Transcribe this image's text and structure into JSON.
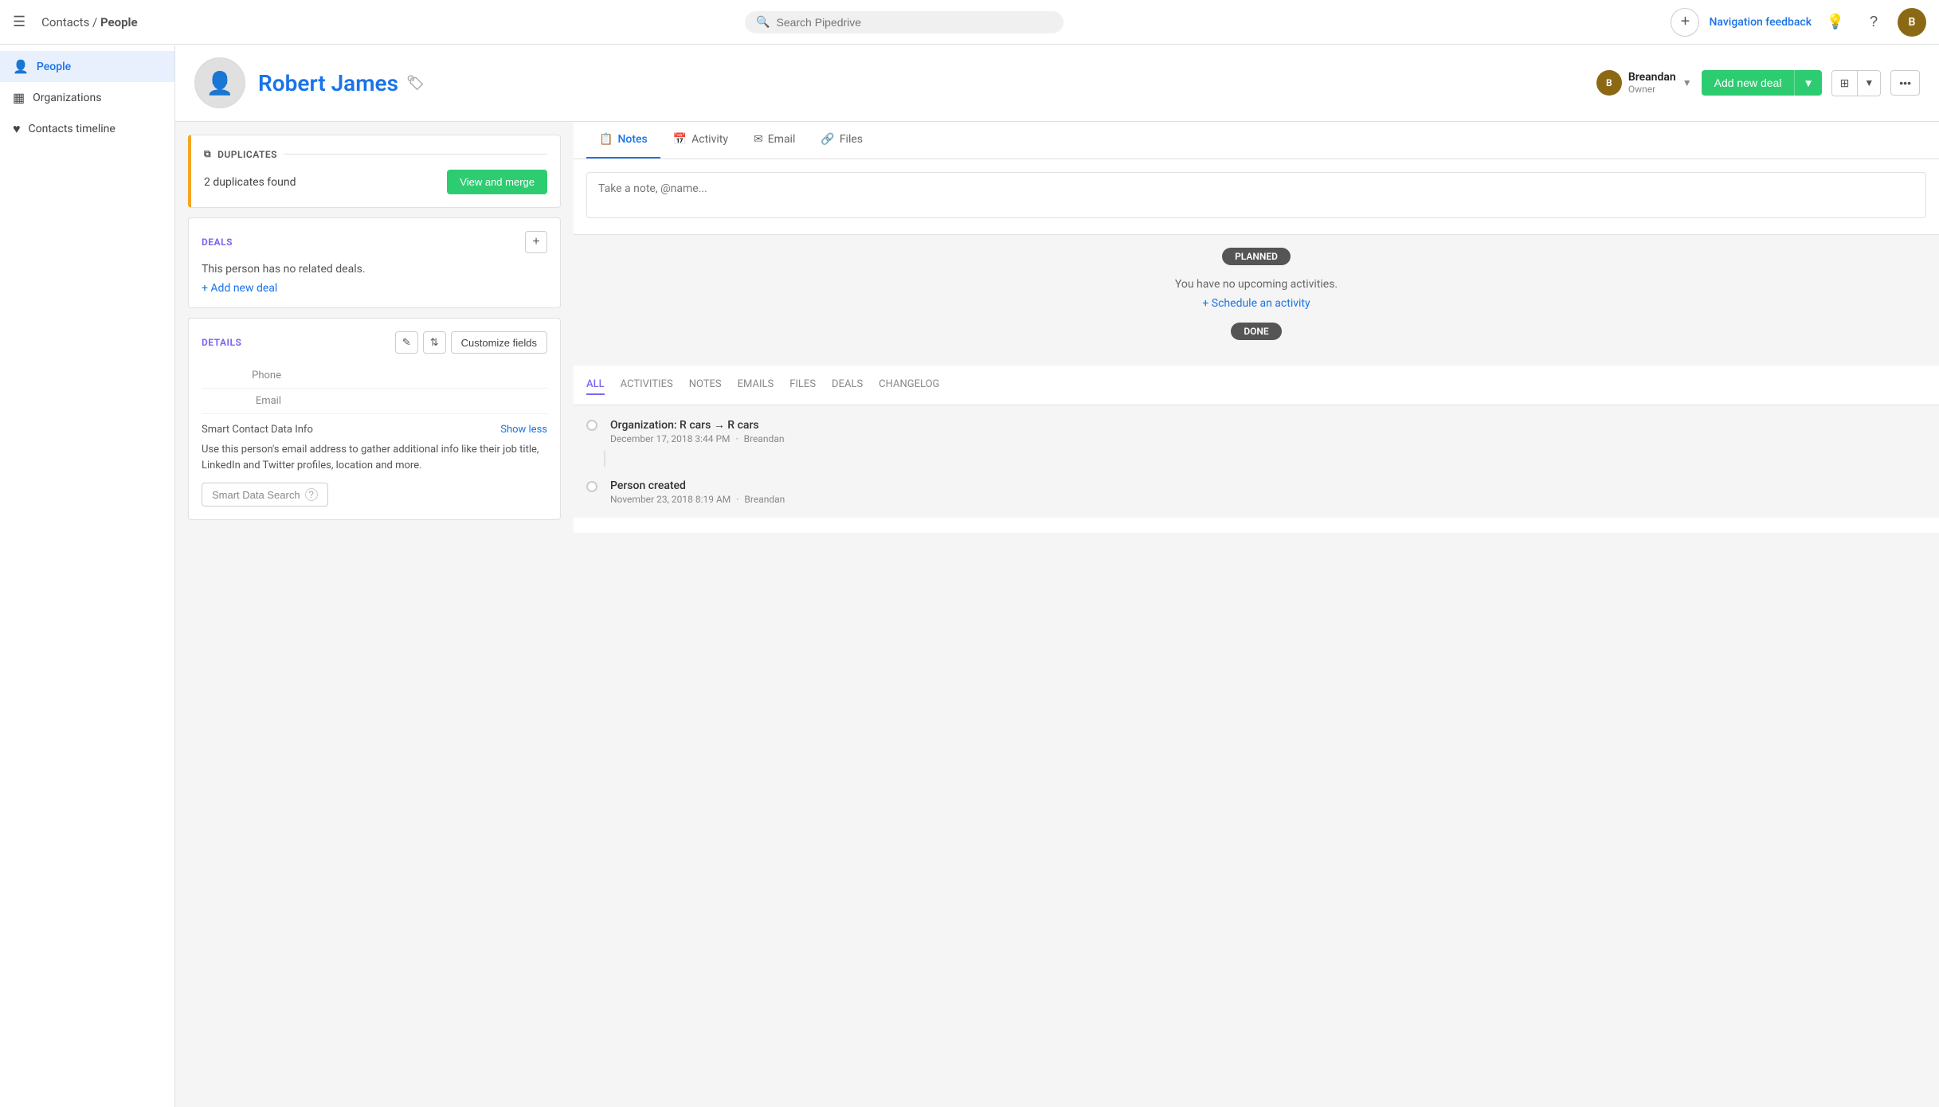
{
  "topNav": {
    "hamburger": "☰",
    "breadcrumb": "Contacts / ",
    "breadcrumbBold": "People",
    "searchPlaceholder": "Search Pipedrive",
    "addButtonLabel": "+",
    "feedbackLabel": "Navigation feedback",
    "lightbulbIcon": "💡",
    "helpIcon": "?",
    "avatarInitials": "B"
  },
  "sidebar": {
    "items": [
      {
        "id": "people",
        "icon": "👤",
        "label": "People",
        "active": true
      },
      {
        "id": "organizations",
        "icon": "▦",
        "label": "Organizations",
        "active": false
      },
      {
        "id": "contacts-timeline",
        "icon": "♥",
        "label": "Contacts timeline",
        "active": false
      }
    ]
  },
  "personHeader": {
    "avatarIcon": "👤",
    "name": "Robert James",
    "tagIcon": "🏷",
    "owner": {
      "name": "Breandan",
      "label": "Owner",
      "avatarInitials": "B"
    },
    "addDealLabel": "Add new deal",
    "viewToggleIcon": "⊞",
    "moreIcon": "•••"
  },
  "duplicatesCard": {
    "icon": "⧉",
    "title": "DUPLICATES",
    "message": "2 duplicates found",
    "buttonLabel": "View and merge"
  },
  "dealsCard": {
    "title": "DEALS",
    "noDealsText": "This person has no related deals.",
    "addDealLink": "+ Add new deal"
  },
  "detailsCard": {
    "title": "DETAILS",
    "editIcon": "✎",
    "sortIcon": "⇅",
    "customizeLabel": "Customize fields",
    "fields": [
      {
        "label": "Phone",
        "value": ""
      },
      {
        "label": "Email",
        "value": ""
      }
    ],
    "smartContact": {
      "title": "Smart Contact Data Info",
      "showLessLabel": "Show less",
      "description": "Use this person's email address to gather additional info like their job title, LinkedIn and Twitter profiles, location and more.",
      "buttonLabel": "Smart Data Search",
      "buttonIcon": "?"
    }
  },
  "rightPanel": {
    "tabs": [
      {
        "id": "notes",
        "icon": "📋",
        "label": "Notes",
        "active": true
      },
      {
        "id": "activity",
        "icon": "📅",
        "label": "Activity",
        "active": false
      },
      {
        "id": "email",
        "icon": "✉",
        "label": "Email",
        "active": false
      },
      {
        "id": "files",
        "icon": "🔗",
        "label": "Files",
        "active": false
      }
    ],
    "notePlaceholder": "Take a note, @name...",
    "planned": {
      "badge": "PLANNED",
      "noActivitiesText": "You have no upcoming activities.",
      "scheduleLink": "+ Schedule an activity"
    },
    "done": {
      "badge": "DONE"
    },
    "historyTabs": [
      {
        "id": "all",
        "label": "ALL",
        "active": true
      },
      {
        "id": "activities",
        "label": "ACTIVITIES",
        "active": false
      },
      {
        "id": "notes",
        "label": "NOTES",
        "active": false
      },
      {
        "id": "emails",
        "label": "EMAILS",
        "active": false
      },
      {
        "id": "files",
        "label": "FILES",
        "active": false
      },
      {
        "id": "deals",
        "label": "DEALS",
        "active": false
      },
      {
        "id": "changelog",
        "label": "CHANGELOG",
        "active": false
      }
    ],
    "historyItems": [
      {
        "title": "Organization: R cars → R cars",
        "date": "December 17, 2018 3:44 PM",
        "separator": "·",
        "author": "Breandan"
      },
      {
        "title": "Person created",
        "date": "November 23, 2018 8:19 AM",
        "separator": "·",
        "author": "Breandan"
      }
    ]
  }
}
